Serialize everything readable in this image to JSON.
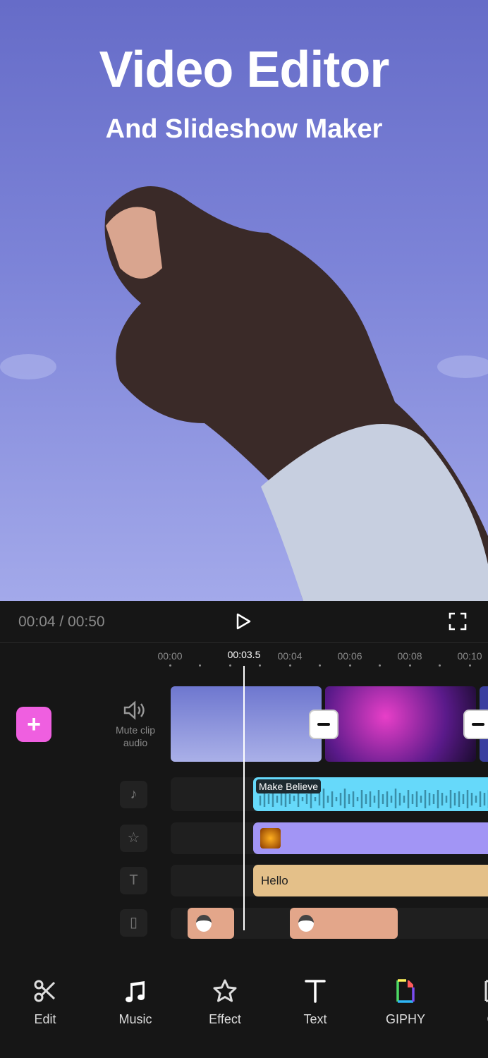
{
  "hero": {
    "title": "Video Editor",
    "subtitle": "And Slideshow Maker"
  },
  "player": {
    "time": "00:04 / 00:50",
    "play_icon": "play-icon",
    "fullscreen_icon": "fullscreen-icon"
  },
  "ruler": {
    "ticks": [
      "00:00",
      "00:04",
      "00:06",
      "00:08",
      "00:10"
    ],
    "current": "00:03.5"
  },
  "video_track": {
    "mute_label": "Mute clip audio"
  },
  "tracks": {
    "music_clip": "Make Believe",
    "text_clip": "Hello"
  },
  "colors": {
    "accent": "#ef5fe0",
    "music": "#66d9fa",
    "effect": "#a295f5",
    "text": "#e4c089",
    "sticker": "#e3a68a"
  },
  "toolbar": [
    "Edit",
    "Music",
    "Effect",
    "Text",
    "GIPHY",
    "Ca"
  ]
}
